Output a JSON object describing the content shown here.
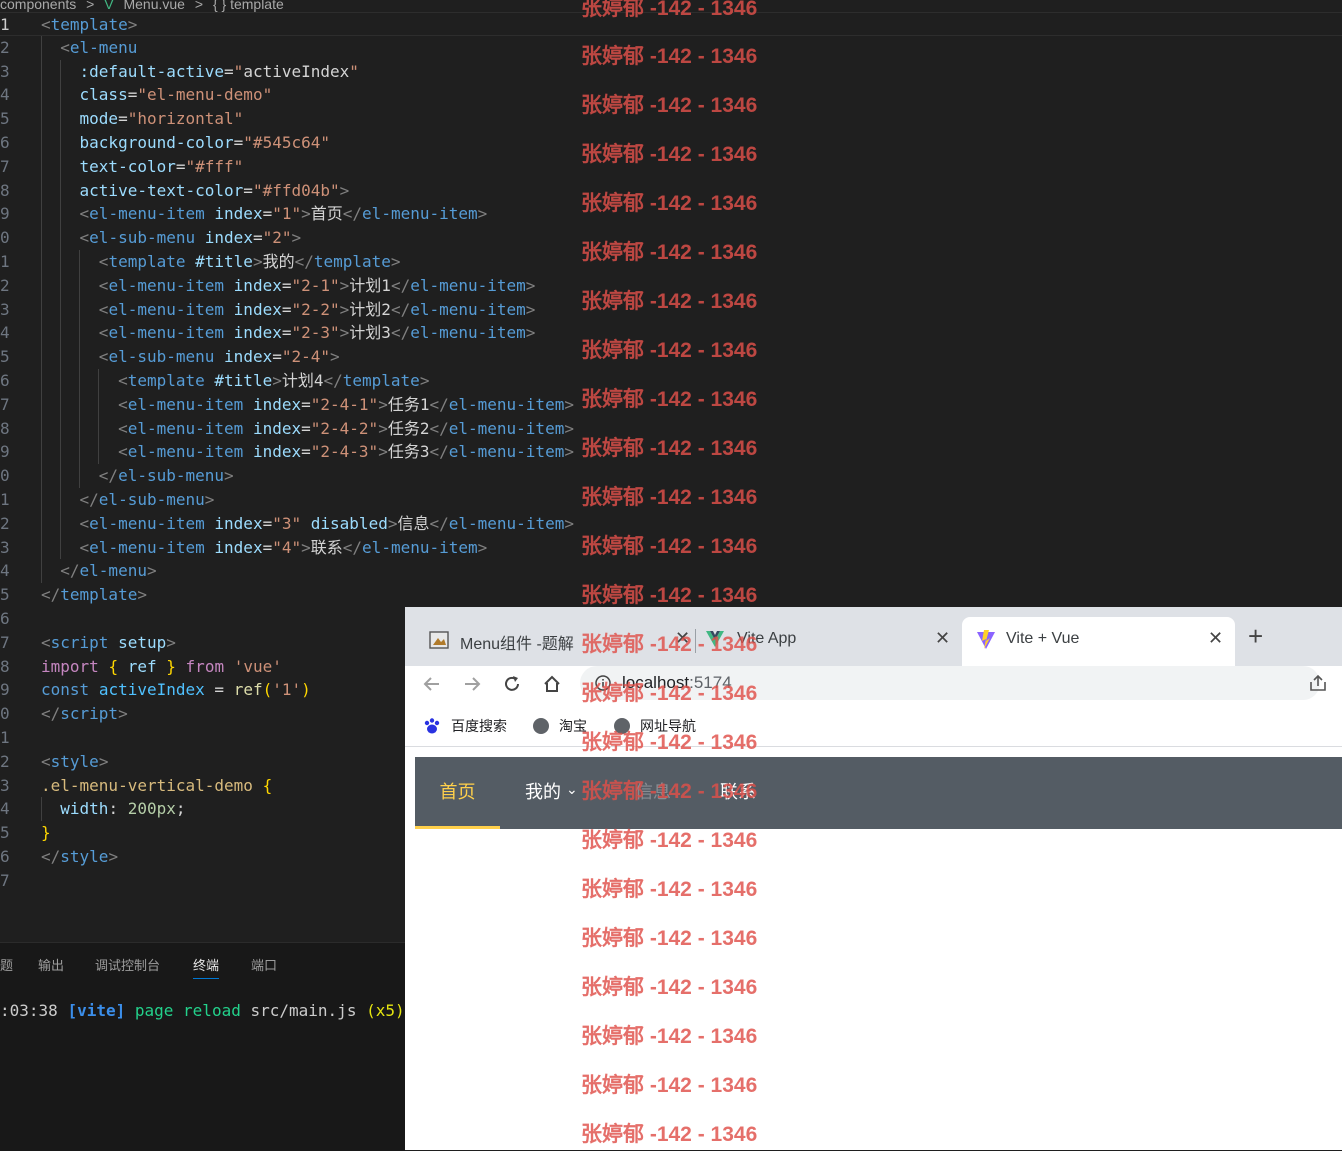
{
  "breadcrumb": {
    "folder": "components",
    "sep": ">",
    "vue_mark": "V",
    "file": "Menu.vue",
    "sep2": ">",
    "symbol": "{ } template"
  },
  "code": {
    "l1": "1",
    "l2": "2",
    "l3": "3",
    "l4": "4",
    "l5": "5",
    "l6": "6",
    "l7": "7",
    "l8": "8",
    "l9": "9",
    "l10": "0",
    "l11": "1",
    "l12": "2",
    "l13": "3",
    "l14": "4",
    "l15": "5",
    "l16": "6",
    "l17": "7",
    "l18": "8",
    "l19": "9",
    "l20": "0",
    "l21": "1",
    "l22": "2",
    "l23": "3",
    "l24": "4",
    "l25": "5",
    "l26": "6",
    "l27": "7",
    "l28": "8",
    "l29": "9",
    "l30": "0",
    "l31": "1",
    "l32": "2",
    "l33": "3",
    "l34": "4",
    "l35": "5",
    "l36": "6",
    "l37": "7"
  },
  "panel": {
    "tabs": [
      "题",
      "输出",
      "调试控制台",
      "终端",
      "端口"
    ],
    "active_tab": "终端",
    "term_time": ":03:38",
    "term_tag": "[vite]",
    "term_msg": "page reload",
    "term_file": "src/main.js",
    "term_count": "(x5)"
  },
  "browser": {
    "tabs": [
      {
        "title": "Menu组件 -题解",
        "close": "✕"
      },
      {
        "title": "Vite App",
        "close": "✕"
      },
      {
        "title": "Vite + Vue",
        "close": "✕"
      }
    ],
    "new_tab": "+",
    "address_host": "localhost",
    "address_port": ":5174",
    "bookmarks": [
      "百度搜索",
      "淘宝",
      "网址导航"
    ]
  },
  "menu": {
    "items": [
      "首页",
      "我的",
      "信息",
      "联系"
    ],
    "chevron": "⌄",
    "colors": {
      "background": "#545c64",
      "text": "#ffffff",
      "active": "#ffd04b"
    }
  },
  "watermark": "张婷郁 -142 - 1346"
}
